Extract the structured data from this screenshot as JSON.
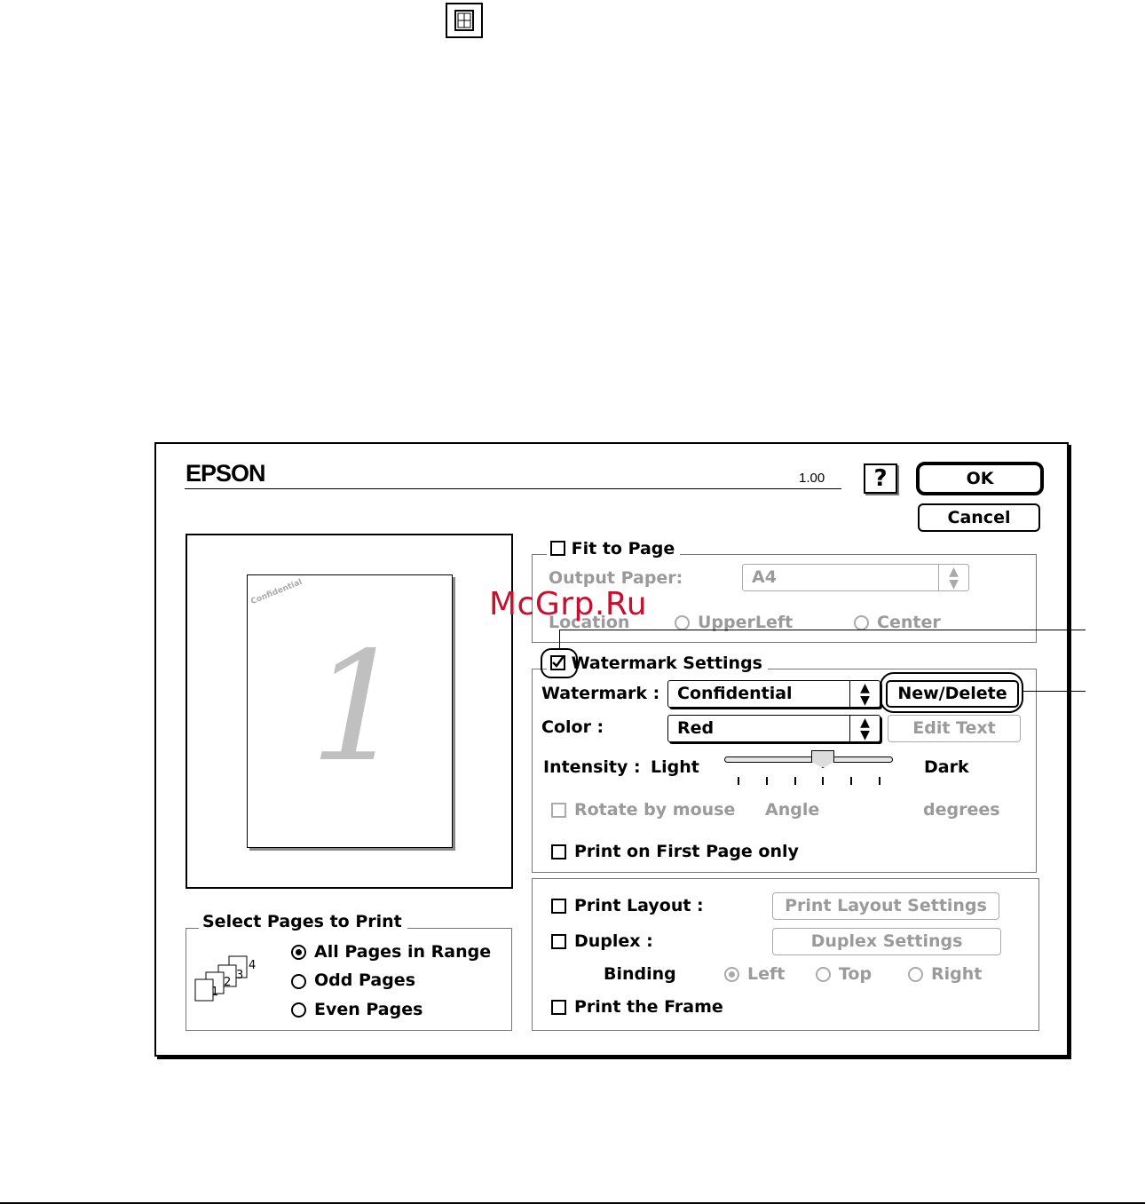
{
  "brand": "EPSON",
  "version": "1.00",
  "buttons": {
    "help": "?",
    "ok": "OK",
    "cancel": "Cancel",
    "new_delete": "New/Delete",
    "edit_text": "Edit Text",
    "print_layout_settings": "Print Layout Settings",
    "duplex_settings": "Duplex Settings"
  },
  "fit_to_page": {
    "label": "Fit to Page",
    "checked": false,
    "output_paper_label": "Output Paper:",
    "output_paper_value": "A4",
    "location_label": "Location",
    "location_options": [
      "UpperLeft",
      "Center"
    ]
  },
  "watermark_settings": {
    "label": "Watermark Settings",
    "checked": true,
    "watermark_label": "Watermark :",
    "watermark_value": "Confidential",
    "color_label": "Color :",
    "color_value": "Red",
    "intensity_label": "Intensity :",
    "light_label": "Light",
    "dark_label": "Dark",
    "intensity_level_fraction": 0.6,
    "rotate_label": "Rotate by mouse",
    "angle_label": "Angle",
    "degrees_label": "degrees",
    "first_page_label": "Print on First Page only"
  },
  "layout": {
    "print_layout_label": "Print Layout :",
    "duplex_label": "Duplex :",
    "binding_label": "Binding",
    "binding_options": [
      "Left",
      "Top",
      "Right"
    ],
    "binding_selected": "Left",
    "frame_label": "Print the Frame"
  },
  "select_pages": {
    "legend": "Select Pages to Print",
    "options": [
      "All Pages in Range",
      "Odd Pages",
      "Even Pages"
    ],
    "selected": "All Pages in Range",
    "icon_pages": [
      "1",
      "2",
      "3",
      "4"
    ]
  },
  "preview": {
    "page_number": "1"
  },
  "site_watermark": "McGrp.Ru",
  "colors": {
    "disabled_text": "#9a9a9a",
    "watermark_red": "#c8102e",
    "preview_number": "#c0c0c0"
  }
}
